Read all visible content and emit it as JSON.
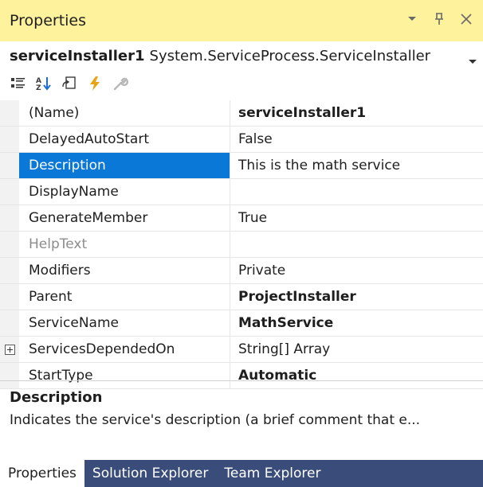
{
  "window": {
    "title": "Properties"
  },
  "object_selector": {
    "name": "serviceInstaller1",
    "type": "System.ServiceProcess.ServiceInstaller"
  },
  "toolbar": {
    "buttons": [
      "categorized-icon",
      "alphabetical-icon",
      "property-pages-icon",
      "events-icon",
      "wrench-icon"
    ]
  },
  "properties": [
    {
      "name": "(Name)",
      "value": "serviceInstaller1",
      "bold": true
    },
    {
      "name": "DelayedAutoStart",
      "value": "False",
      "bold": false
    },
    {
      "name": "Description",
      "value": "This is the math service",
      "bold": false,
      "selected": true
    },
    {
      "name": "DisplayName",
      "value": "",
      "bold": false
    },
    {
      "name": "GenerateMember",
      "value": "True",
      "bold": false
    },
    {
      "name": "HelpText",
      "value": "",
      "bold": false,
      "disabled": true
    },
    {
      "name": "Modifiers",
      "value": "Private",
      "bold": false
    },
    {
      "name": "Parent",
      "value": "ProjectInstaller",
      "bold": true
    },
    {
      "name": "ServiceName",
      "value": "MathService",
      "bold": true
    },
    {
      "name": "ServicesDependedOn",
      "value": "String[] Array",
      "bold": false,
      "expandable": true
    },
    {
      "name": "StartType",
      "value": "Automatic",
      "bold": true
    }
  ],
  "description_panel": {
    "title": "Description",
    "text": "Indicates the service's description (a brief comment that e..."
  },
  "tabs": [
    {
      "label": "Properties",
      "active": true
    },
    {
      "label": "Solution Explorer",
      "active": false
    },
    {
      "label": "Team Explorer",
      "active": false
    }
  ],
  "colors": {
    "title_bar": "#fff29d",
    "selection": "#0a78d7",
    "tab_bar": "#3a4d7a"
  }
}
